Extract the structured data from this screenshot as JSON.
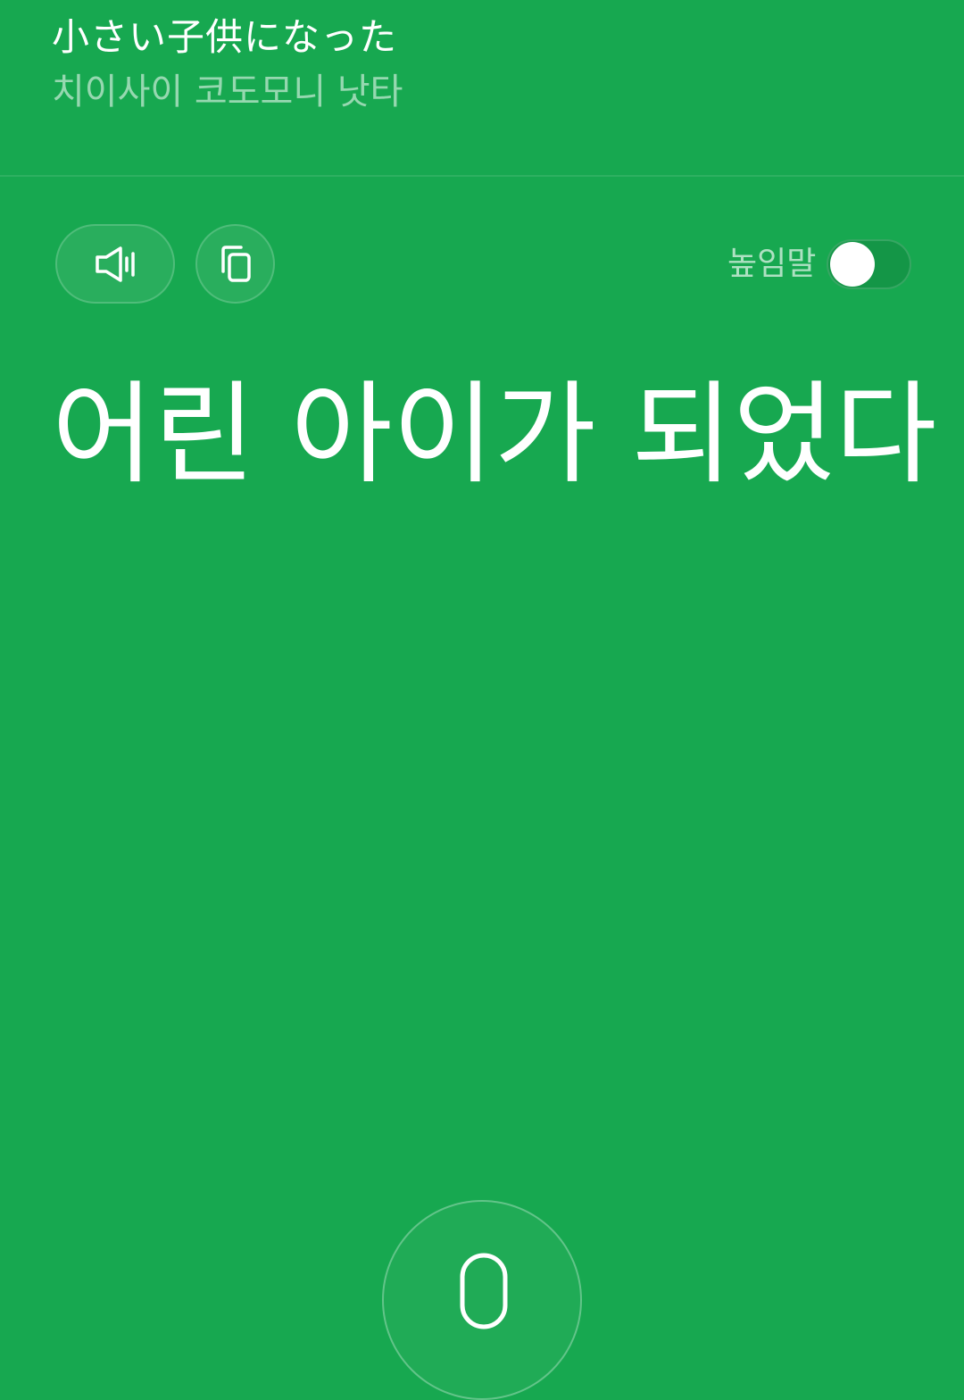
{
  "source": {
    "text": "小さい子供になった",
    "pronunciation": "치이사이 코도모니 낫타"
  },
  "actions": {
    "speak_icon": "speaker-icon",
    "copy_icon": "copy-icon"
  },
  "honorific": {
    "label": "높임말",
    "enabled": false
  },
  "translation": {
    "text": "어린 아이가 되었다"
  },
  "mic": {
    "icon": "microphone-icon"
  },
  "colors": {
    "background": "#17a850",
    "text": "#ffffff"
  }
}
